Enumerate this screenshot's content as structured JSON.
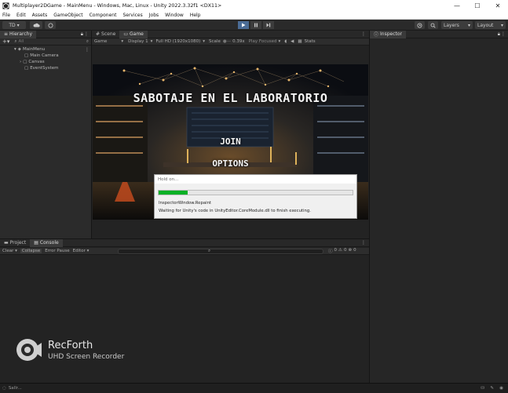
{
  "window": {
    "title": "Multiplayer2DGame - MainMenu - Windows, Mac, Linux - Unity 2022.3.32f1 <DX11>",
    "minimize": "—",
    "maximize": "☐",
    "close": "✕"
  },
  "menu": [
    "File",
    "Edit",
    "Assets",
    "GameObject",
    "Component",
    "Services",
    "Jobs",
    "Window",
    "Help"
  ],
  "toolbar": {
    "account": "TD ▾",
    "layers": "Layers",
    "layout": "Layout"
  },
  "hierarchy": {
    "tab": "Hierarchy",
    "search_placeholder": "All",
    "items": [
      "MainMenu",
      "Main Camera",
      "Canvas",
      "EventSystem"
    ]
  },
  "gamepanel": {
    "tabs": [
      "Scene",
      "Game"
    ],
    "mode": "Game",
    "display": "Display 1",
    "resolution": "Full HD (1920x1080)",
    "scale_label": "Scale",
    "scale_value": "0.39x",
    "play_focused": "Play Focused",
    "stats": "Stats"
  },
  "game": {
    "title": "SABOTAJE EN EL LABORATORIO",
    "join": "JOIN",
    "options": "OPTIONS"
  },
  "dialog": {
    "title": "Hold on...",
    "progress_fraction": 0.15,
    "progress_color": "#06b025",
    "line1": "InspectorWindow.Repaint",
    "line2": "Waiting for Unity's code in UnityEditor.CoreModule.dll to finish executing."
  },
  "inspector": {
    "tab": "Inspector"
  },
  "bottom": {
    "tabs": [
      "Project",
      "Console"
    ],
    "buttons": [
      "Clear ▾",
      "Collapse",
      "Error Pause",
      "Editor ▾"
    ],
    "counts": [
      "0",
      "0",
      "0"
    ]
  },
  "watermark": {
    "name": "RecForth",
    "subtitle": "UHD Screen Recorder"
  },
  "status": {
    "text": "Sallr..."
  }
}
